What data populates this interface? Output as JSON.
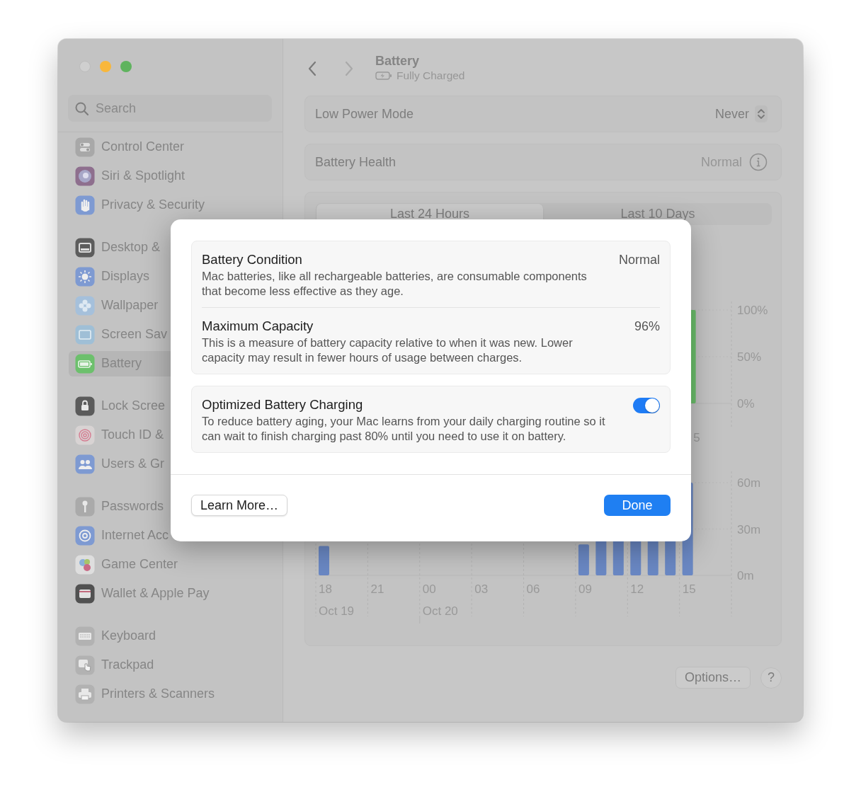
{
  "window": {
    "traffic_lights": [
      {
        "kind": "close",
        "disabled": true
      },
      {
        "kind": "minimize",
        "disabled": false
      },
      {
        "kind": "zoom",
        "disabled": false
      }
    ]
  },
  "sidebar": {
    "search": {
      "placeholder": "Search"
    },
    "groups": [
      {
        "items": [
          {
            "label": "Control Center",
            "selected": false
          },
          {
            "label": "Siri & Spotlight",
            "selected": false
          },
          {
            "label": "Privacy & Security",
            "selected": false
          }
        ]
      },
      {
        "items": [
          {
            "label": "Desktop &",
            "selected": false
          },
          {
            "label": "Displays",
            "selected": false
          },
          {
            "label": "Wallpaper",
            "selected": false
          },
          {
            "label": "Screen Sav",
            "selected": false
          },
          {
            "label": "Battery",
            "selected": true
          }
        ]
      },
      {
        "items": [
          {
            "label": "Lock Scree",
            "selected": false
          },
          {
            "label": "Touch ID &",
            "selected": false
          },
          {
            "label": "Users & Gr",
            "selected": false
          }
        ]
      },
      {
        "items": [
          {
            "label": "Passwords",
            "selected": false
          },
          {
            "label": "Internet Acc",
            "selected": false
          },
          {
            "label": "Game Center",
            "selected": false
          },
          {
            "label": "Wallet & Apple Pay",
            "selected": false
          }
        ]
      },
      {
        "items": [
          {
            "label": "Keyboard",
            "selected": false
          },
          {
            "label": "Trackpad",
            "selected": false
          },
          {
            "label": "Printers & Scanners",
            "selected": false
          }
        ]
      }
    ]
  },
  "header": {
    "title": "Battery",
    "subtitle": "Fully Charged",
    "back_disabled": false,
    "forward_disabled": true
  },
  "settings": [
    {
      "kind": "popup",
      "label": "Low Power Mode",
      "value": "Never"
    },
    {
      "kind": "info",
      "label": "Battery Health",
      "value": "Normal"
    }
  ],
  "usage": {
    "tabs": [
      {
        "label": "Last 24 Hours",
        "selected": true
      },
      {
        "label": "Last 10 Days",
        "selected": false
      }
    ],
    "battery_chart": {
      "y_labels": [
        "100%",
        "50%",
        "0%"
      ],
      "x_labels": [
        "5"
      ]
    },
    "screen_chart": {
      "y_labels": [
        "60m",
        "30m",
        "0m"
      ],
      "x_labels": [
        "18",
        "21",
        "00",
        "03",
        "06",
        "09",
        "12",
        "15"
      ],
      "date_labels": [
        "Oct 19",
        "Oct 20"
      ]
    }
  },
  "footer": {
    "options_button": "Options…",
    "help_button": "?"
  },
  "dialog": {
    "groups": [
      {
        "rows": [
          {
            "kind": "value",
            "title": "Battery Condition",
            "value": "Normal",
            "description": "Mac batteries, like all rechargeable batteries, are consumable components that become less effective as they age."
          },
          {
            "kind": "value",
            "title": "Maximum Capacity",
            "value": "96%",
            "description": "This is a measure of battery capacity relative to when it was new. Lower capacity may result in fewer hours of usage between charges."
          }
        ]
      },
      {
        "rows": [
          {
            "kind": "toggle",
            "title": "Optimized Battery Charging",
            "on": true,
            "description": "To reduce battery aging, your Mac learns from your daily charging routine so it can wait to finish charging past 80% until you need to use it on battery."
          }
        ]
      }
    ],
    "buttons": [
      {
        "kind": "secondary",
        "label": "Learn More…"
      },
      {
        "kind": "primary",
        "label": "Done"
      }
    ]
  }
}
